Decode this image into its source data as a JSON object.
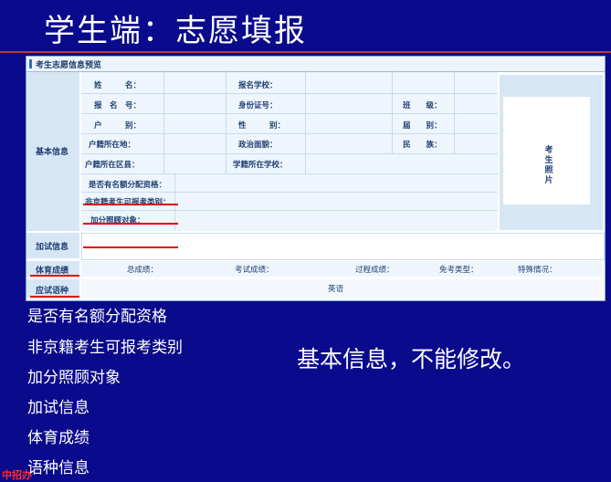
{
  "slide_title": "学生端：志愿填报",
  "form": {
    "header": "考生志愿信息预览",
    "section_basic": "基本信息",
    "section_extra": "加试信息",
    "section_pe": "体育成绩",
    "section_lang": "应试语种",
    "photo_label": "考生照片",
    "fields": {
      "name": "姓　　　名：",
      "reg_no": "报　名　号：",
      "hukou": "户　　　别：",
      "hukou_loc": "户籍所在地：",
      "hukou_district": "户籍所在区县：",
      "school": "报名学校：",
      "id_no": "身份证号：",
      "gender": "性　　　别：",
      "politics": "政治面貌：",
      "school_district": "学籍所在学校：",
      "class": "班　　级：",
      "grade": "届　　别：",
      "ethnicity": "民　　族：",
      "quota": "是否有名额分配资格：",
      "nonlocal": "非京籍考生可报考类别：",
      "bonus": "加分照顾对象："
    },
    "pe": {
      "total": "总成绩：",
      "exam": "考试成绩：",
      "process": "过程成绩：",
      "exempt": "免考类型：",
      "special": "特殊情况："
    },
    "lang_value": "英语"
  },
  "bullets": [
    "是否有名额分配资格",
    "非京籍考生可报考类别",
    "加分照顾对象",
    "加试信息",
    "体育成绩",
    "语种信息"
  ],
  "note": "基本信息，不能修改。",
  "corner_text": "中招办"
}
